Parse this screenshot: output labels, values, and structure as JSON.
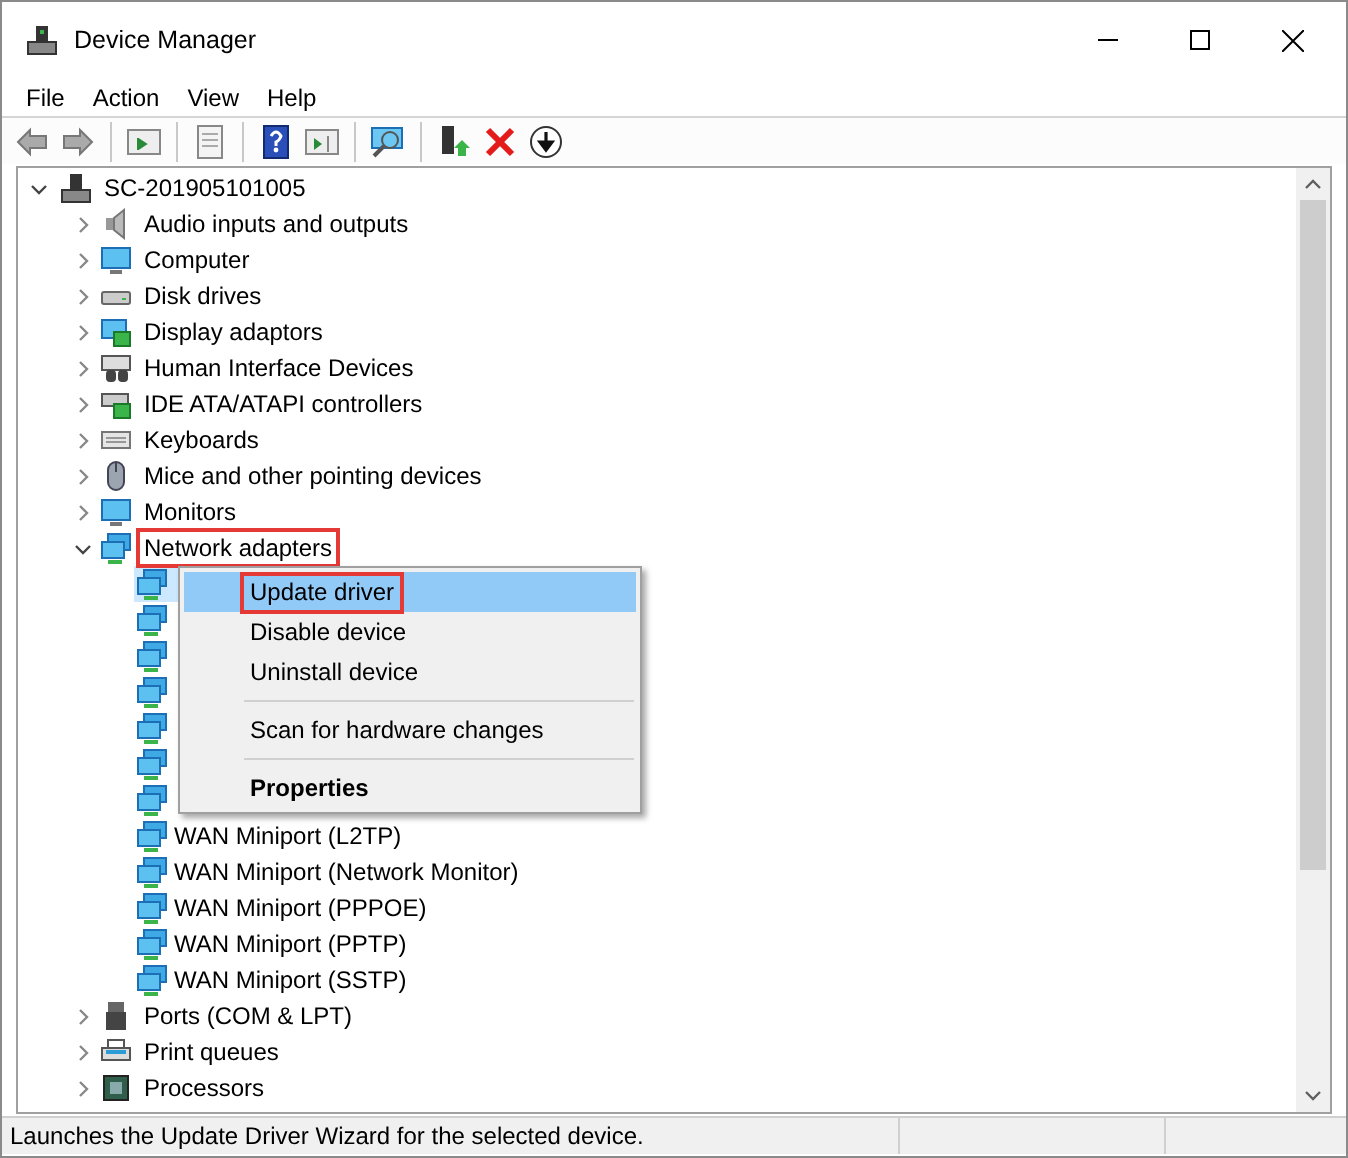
{
  "window": {
    "title": "Device Manager"
  },
  "menu": [
    "File",
    "Action",
    "View",
    "Help"
  ],
  "tree": {
    "label": "SC-201905101005",
    "expanded": true,
    "children": [
      {
        "label": "Audio inputs and outputs",
        "expanded": false,
        "annotated": false
      },
      {
        "label": "Computer",
        "expanded": false,
        "annotated": false
      },
      {
        "label": "Disk drives",
        "expanded": false,
        "annotated": false
      },
      {
        "label": "Display adaptors",
        "expanded": false,
        "annotated": false
      },
      {
        "label": "Human Interface Devices",
        "expanded": false,
        "annotated": false
      },
      {
        "label": "IDE ATA/ATAPI controllers",
        "expanded": false,
        "annotated": false
      },
      {
        "label": "Keyboards",
        "expanded": false,
        "annotated": false
      },
      {
        "label": "Mice and other pointing devices",
        "expanded": false,
        "annotated": false
      },
      {
        "label": "Monitors",
        "expanded": false,
        "annotated": false
      },
      {
        "label": "Network adapters",
        "expanded": true,
        "annotated": true,
        "children": [
          {
            "kind": "covered",
            "selected": true
          },
          {
            "kind": "covered",
            "selected": false
          },
          {
            "kind": "covered",
            "selected": false
          },
          {
            "kind": "covered",
            "selected": false
          },
          {
            "kind": "covered",
            "selected": false
          },
          {
            "kind": "covered",
            "selected": false
          },
          {
            "kind": "covered",
            "selected": false
          },
          {
            "kind": "device",
            "label": "WAN Miniport (L2TP)",
            "selected": false
          },
          {
            "kind": "device",
            "label": "WAN Miniport (Network Monitor)",
            "selected": false
          },
          {
            "kind": "device",
            "label": "WAN Miniport (PPPOE)",
            "selected": false
          },
          {
            "kind": "device",
            "label": "WAN Miniport (PPTP)",
            "selected": false
          },
          {
            "kind": "device",
            "label": "WAN Miniport (SSTP)",
            "selected": false
          }
        ]
      },
      {
        "label": "Ports (COM & LPT)",
        "expanded": false,
        "annotated": false
      },
      {
        "label": "Print queues",
        "expanded": false,
        "annotated": false
      },
      {
        "label": "Processors",
        "expanded": false,
        "annotated": false
      }
    ]
  },
  "context_menu": [
    {
      "kind": "item",
      "label": "Update driver",
      "selected": true,
      "annotated": true
    },
    {
      "kind": "item",
      "label": "Disable device",
      "selected": false,
      "annotated": false
    },
    {
      "kind": "item",
      "label": "Uninstall device",
      "selected": false,
      "annotated": false
    },
    {
      "kind": "separator"
    },
    {
      "kind": "item",
      "label": "Scan for hardware changes",
      "selected": false,
      "annotated": false
    },
    {
      "kind": "separator"
    },
    {
      "kind": "default",
      "label": "Properties",
      "selected": false,
      "annotated": false
    }
  ],
  "status_bar": "Launches the Update Driver Wizard for the selected device."
}
